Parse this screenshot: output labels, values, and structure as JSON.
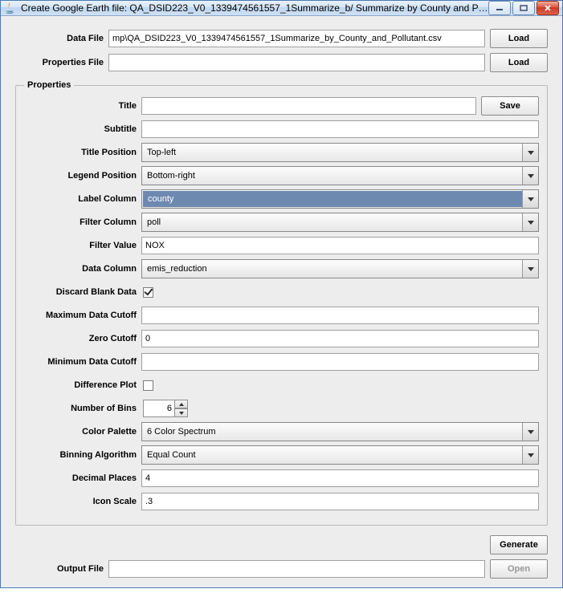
{
  "window": {
    "title": "Create Google Earth file: QA_DSID223_V0_1339474561557_1Summarize_b/ Summarize by County and Pollut..."
  },
  "top": {
    "dataFile": {
      "label": "Data File",
      "value": "mp\\QA_DSID223_V0_1339474561557_1Summarize_by_County_and_Pollutant.csv"
    },
    "propertiesFile": {
      "label": "Properties File",
      "value": ""
    },
    "loadBtn": "Load"
  },
  "props": {
    "legend": "Properties",
    "saveBtn": "Save",
    "title": {
      "label": "Title",
      "value": ""
    },
    "subtitle": {
      "label": "Subtitle",
      "value": ""
    },
    "titlePosition": {
      "label": "Title Position",
      "value": "Top-left"
    },
    "legendPosition": {
      "label": "Legend Position",
      "value": "Bottom-right"
    },
    "labelColumn": {
      "label": "Label Column",
      "value": "county"
    },
    "filterColumn": {
      "label": "Filter Column",
      "value": "poll"
    },
    "filterValue": {
      "label": "Filter Value",
      "value": "NOX"
    },
    "dataColumn": {
      "label": "Data Column",
      "value": "emis_reduction"
    },
    "discardBlank": {
      "label": "Discard Blank Data",
      "checked": true
    },
    "maxCutoff": {
      "label": "Maximum Data Cutoff",
      "value": ""
    },
    "zeroCutoff": {
      "label": "Zero Cutoff",
      "value": "0"
    },
    "minCutoff": {
      "label": "Minimum Data Cutoff",
      "value": ""
    },
    "diffPlot": {
      "label": "Difference Plot",
      "checked": false
    },
    "numBins": {
      "label": "Number of Bins",
      "value": "6"
    },
    "colorPalette": {
      "label": "Color Palette",
      "value": "6 Color Spectrum"
    },
    "binningAlg": {
      "label": "Binning Algorithm",
      "value": "Equal Count"
    },
    "decimalPlaces": {
      "label": "Decimal Places",
      "value": "4"
    },
    "iconScale": {
      "label": "Icon Scale",
      "value": ".3"
    }
  },
  "bottom": {
    "generateBtn": "Generate",
    "outputFile": {
      "label": "Output File",
      "value": ""
    },
    "openBtn": "Open"
  }
}
